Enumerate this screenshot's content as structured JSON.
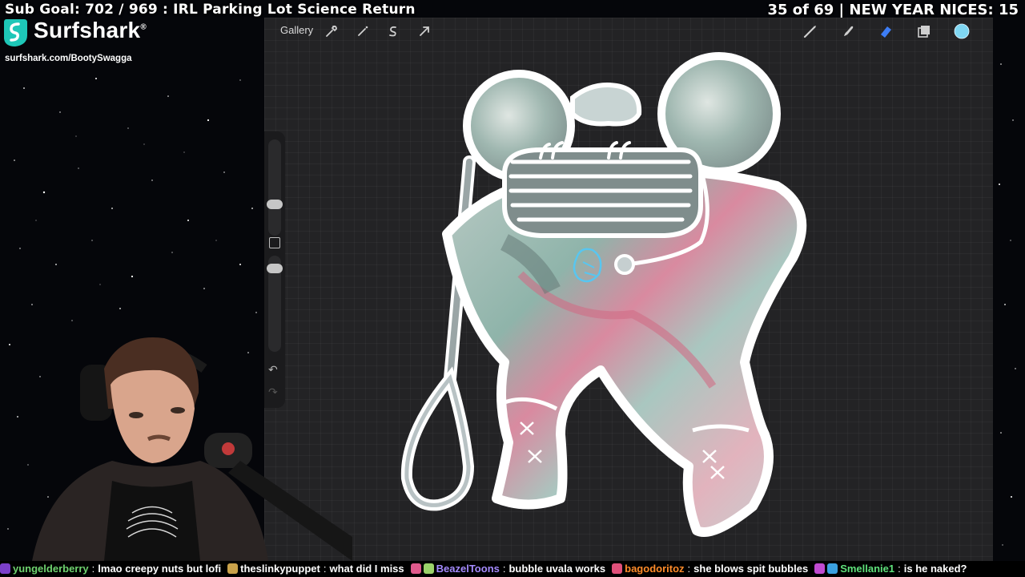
{
  "overlay": {
    "sub_goal": "Sub Goal: 702 / 969 : IRL Parking Lot Science Return",
    "counter": "35 of 69 | NEW YEAR NICES: 15"
  },
  "sponsor": {
    "brand": "Surfshark",
    "registered": "®",
    "url": "surfshark.com/BootySwagga"
  },
  "app": {
    "gallery_label": "Gallery",
    "left_tools": [
      "wrench-icon",
      "magic-wand-icon",
      "selection-s-icon",
      "transform-arrow-icon"
    ],
    "right_tools": [
      "brush-icon",
      "smudge-icon",
      "eraser-icon",
      "layers-icon",
      "color-swatch"
    ],
    "active_color": "#7fd6f2",
    "eraser_active_color": "#3d7df5",
    "sidebar": {
      "undo": "↶",
      "redo": "↷"
    }
  },
  "chat": [
    {
      "badges": [
        "#7b3fc9"
      ],
      "user": "yungelderberry",
      "color": "#6fd36f",
      "text": "lmao creepy nuts but lofi"
    },
    {
      "badges": [
        "#caa24a"
      ],
      "user": "theslinkypuppet",
      "color": "#ffffff",
      "text": "what did I miss"
    },
    {
      "badges": [
        "#e05a8c",
        "#9bd26a"
      ],
      "user": "BeazelToons",
      "color": "#a58bff",
      "text": "bubble uvala works"
    },
    {
      "badges": [
        "#e0507a"
      ],
      "user": "bagodoritoz",
      "color": "#ff8c2a",
      "text": "she blows spit bubbles"
    },
    {
      "badges": [
        "#c04ad0",
        "#3aa0e0"
      ],
      "user": "Smellanie1",
      "color": "#5ee07a",
      "text": "is he naked?"
    }
  ]
}
